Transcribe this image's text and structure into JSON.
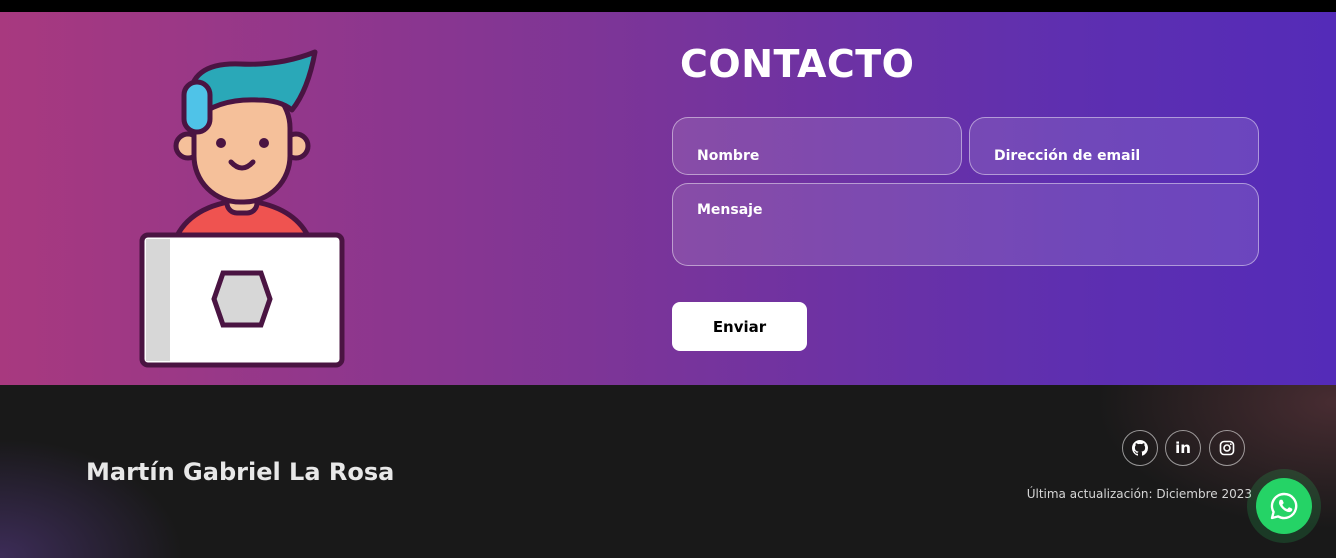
{
  "contact": {
    "title": "CONTACTO",
    "name_placeholder": "Nombre",
    "email_placeholder": "Dirección de email",
    "message_placeholder": "Mensaje",
    "send_label": "Enviar"
  },
  "footer": {
    "author": "Martín Gabriel La Rosa",
    "social": [
      {
        "icon": "github-icon"
      },
      {
        "icon": "linkedin-icon",
        "glyph": "in"
      },
      {
        "icon": "instagram-icon"
      }
    ],
    "last_update": "Última actualización: Diciembre 2023"
  },
  "floating": {
    "icon": "whatsapp-icon"
  },
  "colors": {
    "gradient_start": "#a8397f",
    "gradient_end": "#542bb8",
    "footer_bg": "#191919",
    "whatsapp_green": "#25d366"
  }
}
